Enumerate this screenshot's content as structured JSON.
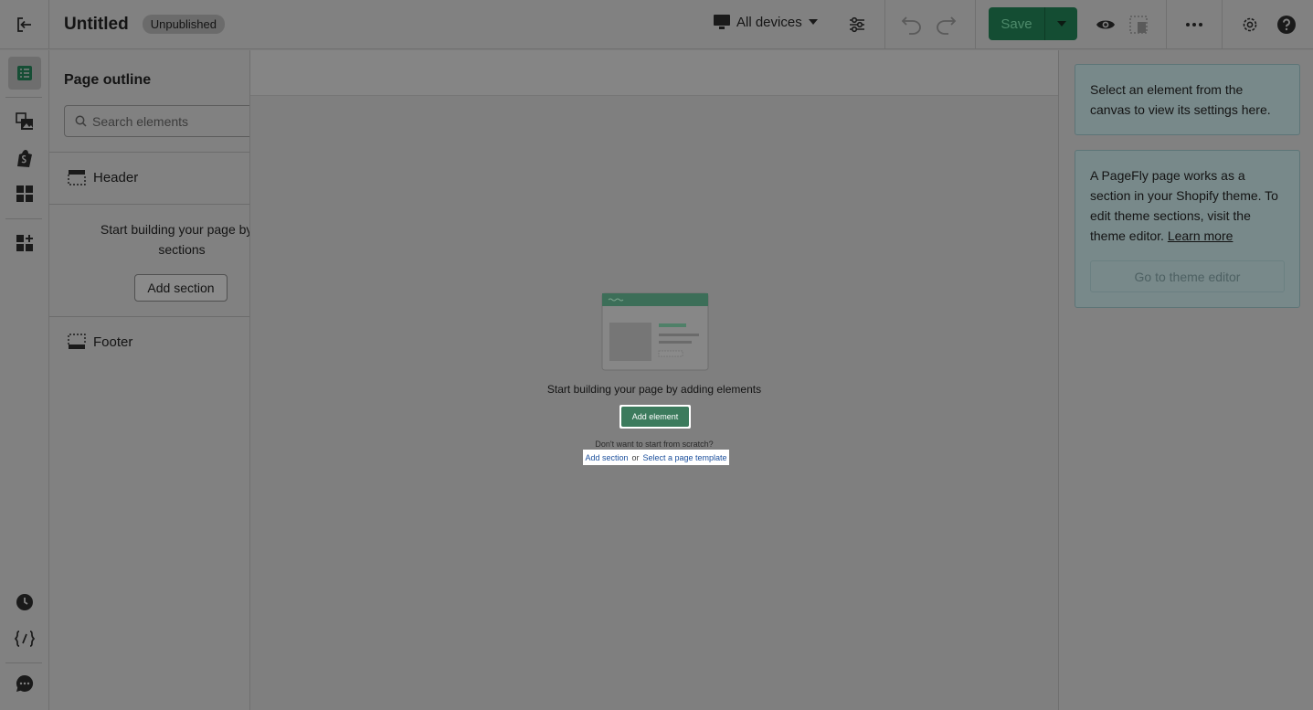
{
  "header": {
    "title": "Untitled",
    "status_badge": "Unpublished",
    "device_label": "All devices",
    "save_label": "Save"
  },
  "outline": {
    "title": "Page outline",
    "search_placeholder": "Search elements",
    "header_label": "Header",
    "empty_message": "Start building your page by a sections",
    "add_section_label": "Add section",
    "footer_label": "Footer"
  },
  "canvas": {
    "empty_message": "Start building your page by adding elements",
    "add_element_label": "Add element",
    "scratch_prompt": "Don't want to start from scratch?",
    "add_section_link": "Add section",
    "or_text": "or",
    "template_link": "Select a page template"
  },
  "settings": {
    "hint": "Select an element from the canvas to view its settings here.",
    "theme_info": "A PageFly page works as a section in your Shopify theme. To edit theme sections, visit the theme editor.",
    "learn_more": "Learn more",
    "theme_editor_button": "Go to theme editor"
  },
  "colors": {
    "overlay": "#7e7e7e",
    "save_bg": "#144d33",
    "add_element_bg": "#3c7b5d",
    "link": "#1b4f9c",
    "info_card_bg": "#78898a"
  }
}
